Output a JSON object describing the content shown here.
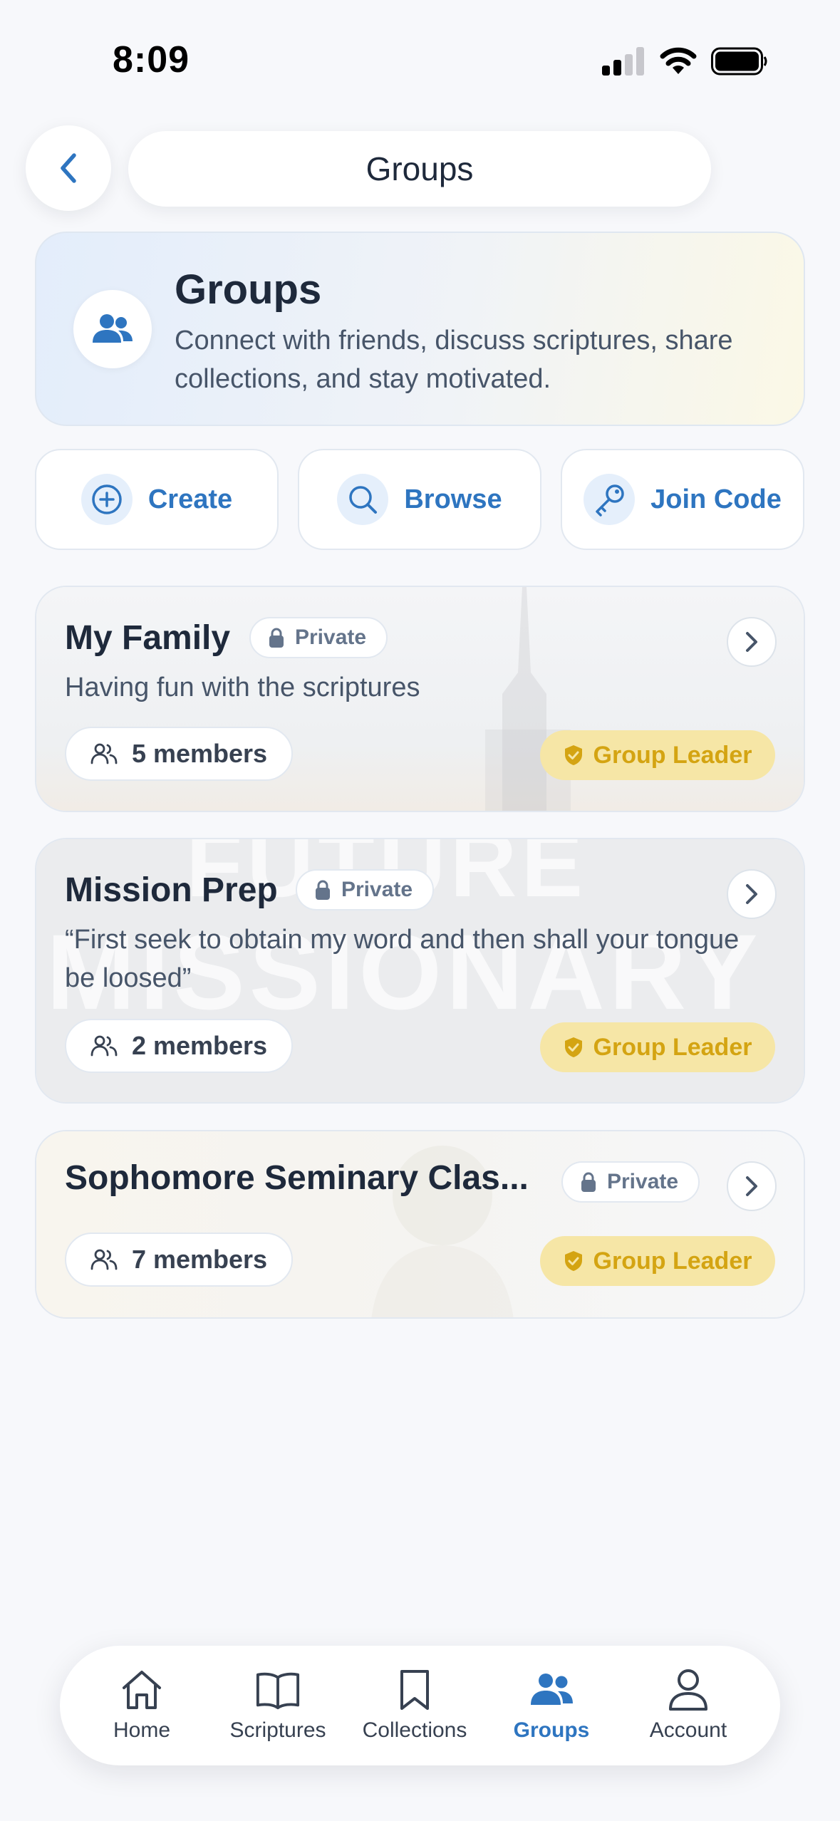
{
  "status_bar": {
    "time": "8:09"
  },
  "header": {
    "title": "Groups"
  },
  "intro": {
    "title": "Groups",
    "description": "Connect with friends, discuss scriptures, share collections, and stay motivated."
  },
  "actions": [
    {
      "label": "Create",
      "icon": "plus-circle-icon"
    },
    {
      "label": "Browse",
      "icon": "search-icon"
    },
    {
      "label": "Join Code",
      "icon": "key-icon"
    }
  ],
  "groups": [
    {
      "name": "My Family",
      "privacy": "Private",
      "description": "Having fun with the scriptures",
      "members": "5 members",
      "role": "Group Leader"
    },
    {
      "name": "Mission Prep",
      "privacy": "Private",
      "description": "“First seek to obtain my word and then shall your tongue be loosed”",
      "members": "2 members",
      "role": "Group Leader",
      "background_text_1": "FUTURE",
      "background_text_2": "MISSIONARY"
    },
    {
      "name": "Sophomore Seminary Clas...",
      "privacy": "Private",
      "members": "7 members",
      "role": "Group Leader"
    }
  ],
  "nav": {
    "items": [
      {
        "label": "Home",
        "icon": "home-icon"
      },
      {
        "label": "Scriptures",
        "icon": "book-icon"
      },
      {
        "label": "Collections",
        "icon": "bookmark-icon"
      },
      {
        "label": "Groups",
        "icon": "users-icon"
      },
      {
        "label": "Account",
        "icon": "person-icon"
      }
    ],
    "active": "Groups"
  },
  "colors": {
    "accent": "#2e75c0",
    "leader_text": "#d4a412",
    "leader_bg": "#f6e6a6",
    "background": "#f7f8fb"
  }
}
